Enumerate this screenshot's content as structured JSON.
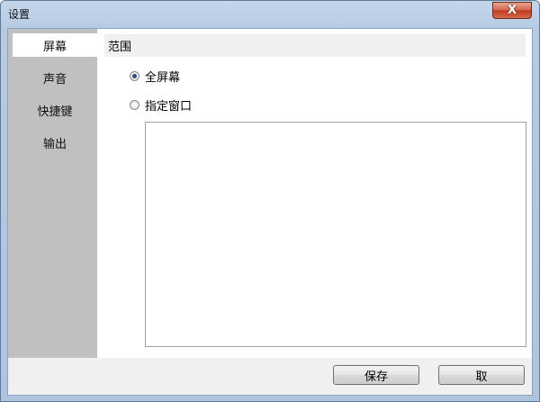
{
  "window": {
    "title": "设置",
    "close_symbol": "X"
  },
  "sidebar": {
    "items": [
      {
        "label": "屏幕",
        "active": true
      },
      {
        "label": "声音"
      },
      {
        "label": "快捷键"
      },
      {
        "label": "输出"
      }
    ]
  },
  "range": {
    "header": "范围",
    "options": [
      {
        "label": "全屏幕",
        "selected": true
      },
      {
        "label": "指定窗口",
        "selected": false
      }
    ]
  },
  "footer": {
    "save_label": "保存",
    "cancel_label": "取"
  },
  "icons": {
    "close": "close-icon",
    "radio": "radio-icon"
  },
  "colors": {
    "sidebar_bg": "#c0c0c0",
    "close_button": "#c0391f"
  }
}
